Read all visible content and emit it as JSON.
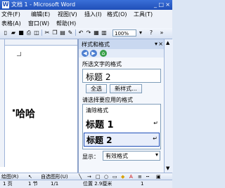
{
  "window": {
    "title": "文档 1 - Microsoft Word"
  },
  "menubar": {
    "row1": [
      "文件(F)",
      "编辑(E)",
      "视图(V)",
      "插入(I)",
      "格式(O)",
      "工具(T)"
    ],
    "row2": [
      "表格(A)",
      "窗口(W)",
      "帮助(H)"
    ]
  },
  "toolbar": {
    "zoom": "100%"
  },
  "document": {
    "text": "哈哈"
  },
  "task_pane": {
    "title": "样式和格式",
    "selected_label": "所选文字的格式",
    "selected_value": "标题 2",
    "select_all_button": "全选",
    "new_style_button": "新样式...",
    "apply_label": "请选择要应用的格式",
    "styles": [
      "清除格式",
      "标题 1",
      "标题 2"
    ],
    "show_label": "显示：",
    "show_value": "有效格式"
  },
  "drawbar": {
    "draw_label": "绘图(R)",
    "autoshape_label": "自选图形(U)"
  },
  "statusbar": {
    "page": "1 页",
    "section": "1 节",
    "page_of": "1/1",
    "position": "位置 2.9厘米",
    "line": "1"
  },
  "colors": {
    "titlebar": "#1f4fb8",
    "accent": "#4d7fd0"
  }
}
